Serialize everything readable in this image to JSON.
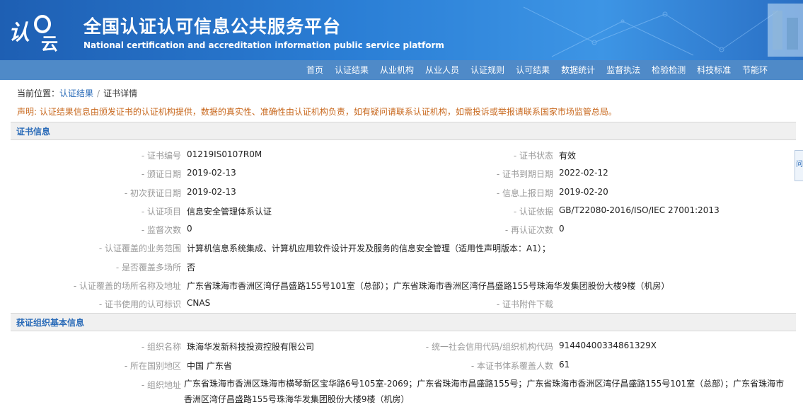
{
  "header": {
    "logo_text": "认云",
    "title_cn": "全国认证认可信息公共服务平台",
    "title_en": "National certification and accreditation information public service platform"
  },
  "nav": {
    "items": [
      "首页",
      "认证结果",
      "从业机构",
      "从业人员",
      "认证规则",
      "认可结果",
      "数据统计",
      "监督执法",
      "检验检测",
      "科技标准",
      "节能环"
    ]
  },
  "breadcrumb": {
    "prefix": "当前位置：",
    "link": "认证结果",
    "sep": "/",
    "current": "证书详情"
  },
  "notice": "声明: 认证结果信息由颁发证书的认证机构提供，数据的真实性、准确性由认证机构负责，如有疑问请联系认证机构，如需投诉或举报请联系国家市场监管总局。",
  "cert_section": {
    "title": "证书信息",
    "rows": [
      {
        "l_label": "- 证书编号",
        "l_value": "01219IS0107R0M",
        "r_label": "- 证书状态",
        "r_value": "有效"
      },
      {
        "l_label": "- 颁证日期",
        "l_value": "2019-02-13",
        "r_label": "- 证书到期日期",
        "r_value": "2022-02-12"
      },
      {
        "l_label": "- 初次获证日期",
        "l_value": "2019-02-13",
        "r_label": "- 信息上报日期",
        "r_value": "2019-02-20"
      },
      {
        "l_label": "- 认证项目",
        "l_value": "信息安全管理体系认证",
        "r_label": "- 认证依据",
        "r_value": "GB/T22080-2016/ISO/IEC 27001:2013"
      },
      {
        "l_label": "- 监督次数",
        "l_value": "0",
        "r_label": "- 再认证次数",
        "r_value": "0"
      }
    ],
    "scope_label": "- 认证覆盖的业务范围",
    "scope_value": "计算机信息系统集成、计算机应用软件设计开发及服务的信息安全管理（适用性声明版本：A1）；",
    "multi_label": "- 是否覆盖多场所",
    "multi_value": "否",
    "sites_label": "- 认证覆盖的场所名称及地址",
    "sites_value": "广东省珠海市香洲区湾仔昌盛路155号101室（总部）；广东省珠海市香洲区湾仔昌盛路155号珠海华发集团股份大楼9楼（机房）",
    "mark_label": "- 证书使用的认可标识",
    "mark_value": "CNAS",
    "attach_label": "- 证书附件下载"
  },
  "org_section": {
    "title": "获证组织基本信息",
    "rows": [
      {
        "l_label": "- 组织名称",
        "l_value": "珠海华发新科技投资控股有限公司",
        "r_label": "- 统一社会信用代码/组织机构代码",
        "r_value": "91440400334861329X"
      },
      {
        "l_label": "- 所在国别地区",
        "l_value": "中国 广东省",
        "r_label": "- 本证书体系覆盖人数",
        "r_value": "61"
      }
    ],
    "addr_label": "- 组织地址",
    "addr_value": "广东省珠海市香洲区珠海市横琴新区宝华路6号105室-2069；广东省珠海市昌盛路155号；广东省珠海市香洲区湾仔昌盛路155号101室（总部）；广东省珠海市香洲区湾仔昌盛路155号珠海华发集团股份大楼9楼（机房）"
  },
  "side_tab": "问"
}
